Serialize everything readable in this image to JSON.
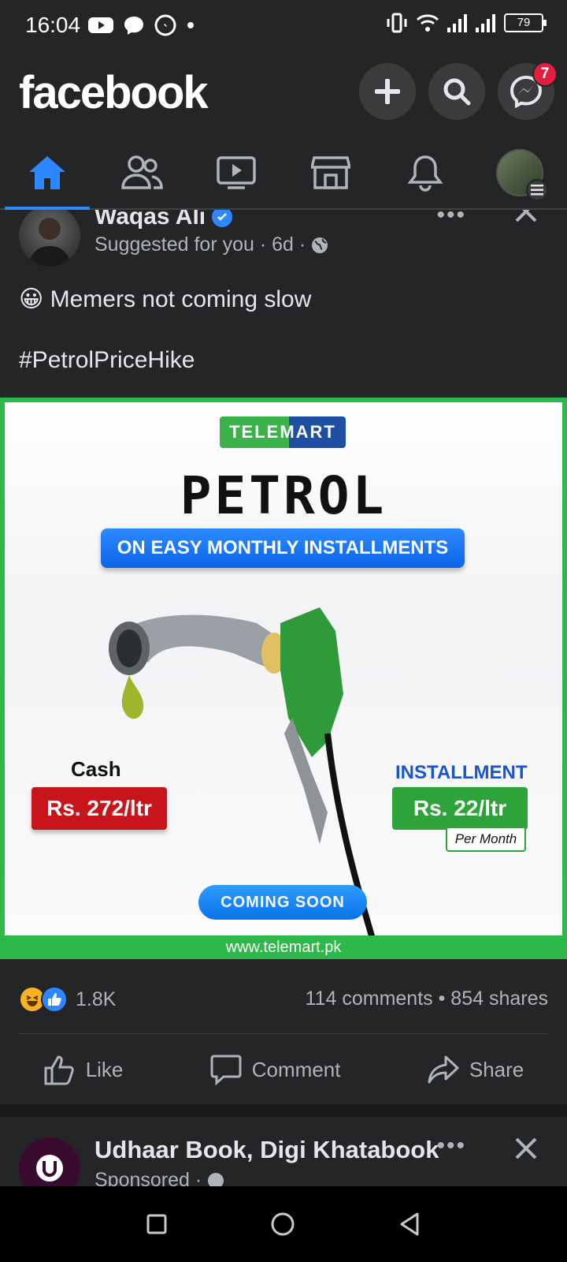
{
  "status_bar": {
    "time": "16:04",
    "battery": "79",
    "left_icons": [
      "youtube-icon",
      "chat-bubble-icon",
      "messenger-icon",
      "dot-icon"
    ],
    "right_icons": [
      "vibrate-icon",
      "wifi-icon",
      "signal-icon",
      "signal-icon",
      "battery-icon"
    ]
  },
  "header": {
    "logo": "facebook",
    "buttons": [
      "create-icon",
      "search-icon",
      "messenger-icon"
    ],
    "messenger_badge": "7"
  },
  "nav_tabs": [
    {
      "name": "home",
      "icon": "home-icon",
      "active": true
    },
    {
      "name": "friends",
      "icon": "friends-icon",
      "active": false
    },
    {
      "name": "watch",
      "icon": "video-icon",
      "active": false
    },
    {
      "name": "marketplace",
      "icon": "store-icon",
      "active": false
    },
    {
      "name": "notifications",
      "icon": "bell-icon",
      "active": false
    },
    {
      "name": "menu",
      "icon": "profile-avatar",
      "active": false
    }
  ],
  "post": {
    "author": "Waqas Ali",
    "meta": "Suggested for you · 6d ·",
    "emoji": "😀",
    "text": "Memers not coming slow",
    "hashtag": "#PetrolPriceHike",
    "ad": {
      "brand": "TELEMART",
      "title": "PETROL",
      "subtitle": "ON EASY MONTHLY INSTALLMENTS",
      "cash_label": "Cash",
      "cash_price": "Rs. 272/ltr",
      "installment_label": "INSTALLMENT",
      "installment_price": "Rs. 22/ltr",
      "per_month": "Per Month",
      "coming_soon": "COMING SOON",
      "url": "www.telemart.pk"
    },
    "reaction_count": "1.8K",
    "engagement": "114 comments • 854 shares",
    "actions": {
      "like": "Like",
      "comment": "Comment",
      "share": "Share"
    }
  },
  "post2": {
    "author": "Udhaar Book, Digi Khatabook",
    "meta": "Sponsored ·",
    "avatar_text": "udhaar book"
  },
  "colors": {
    "background": "#242526",
    "accent": "#2d88ff",
    "badge": "#e41e3f",
    "ad_border": "#2db84a"
  }
}
